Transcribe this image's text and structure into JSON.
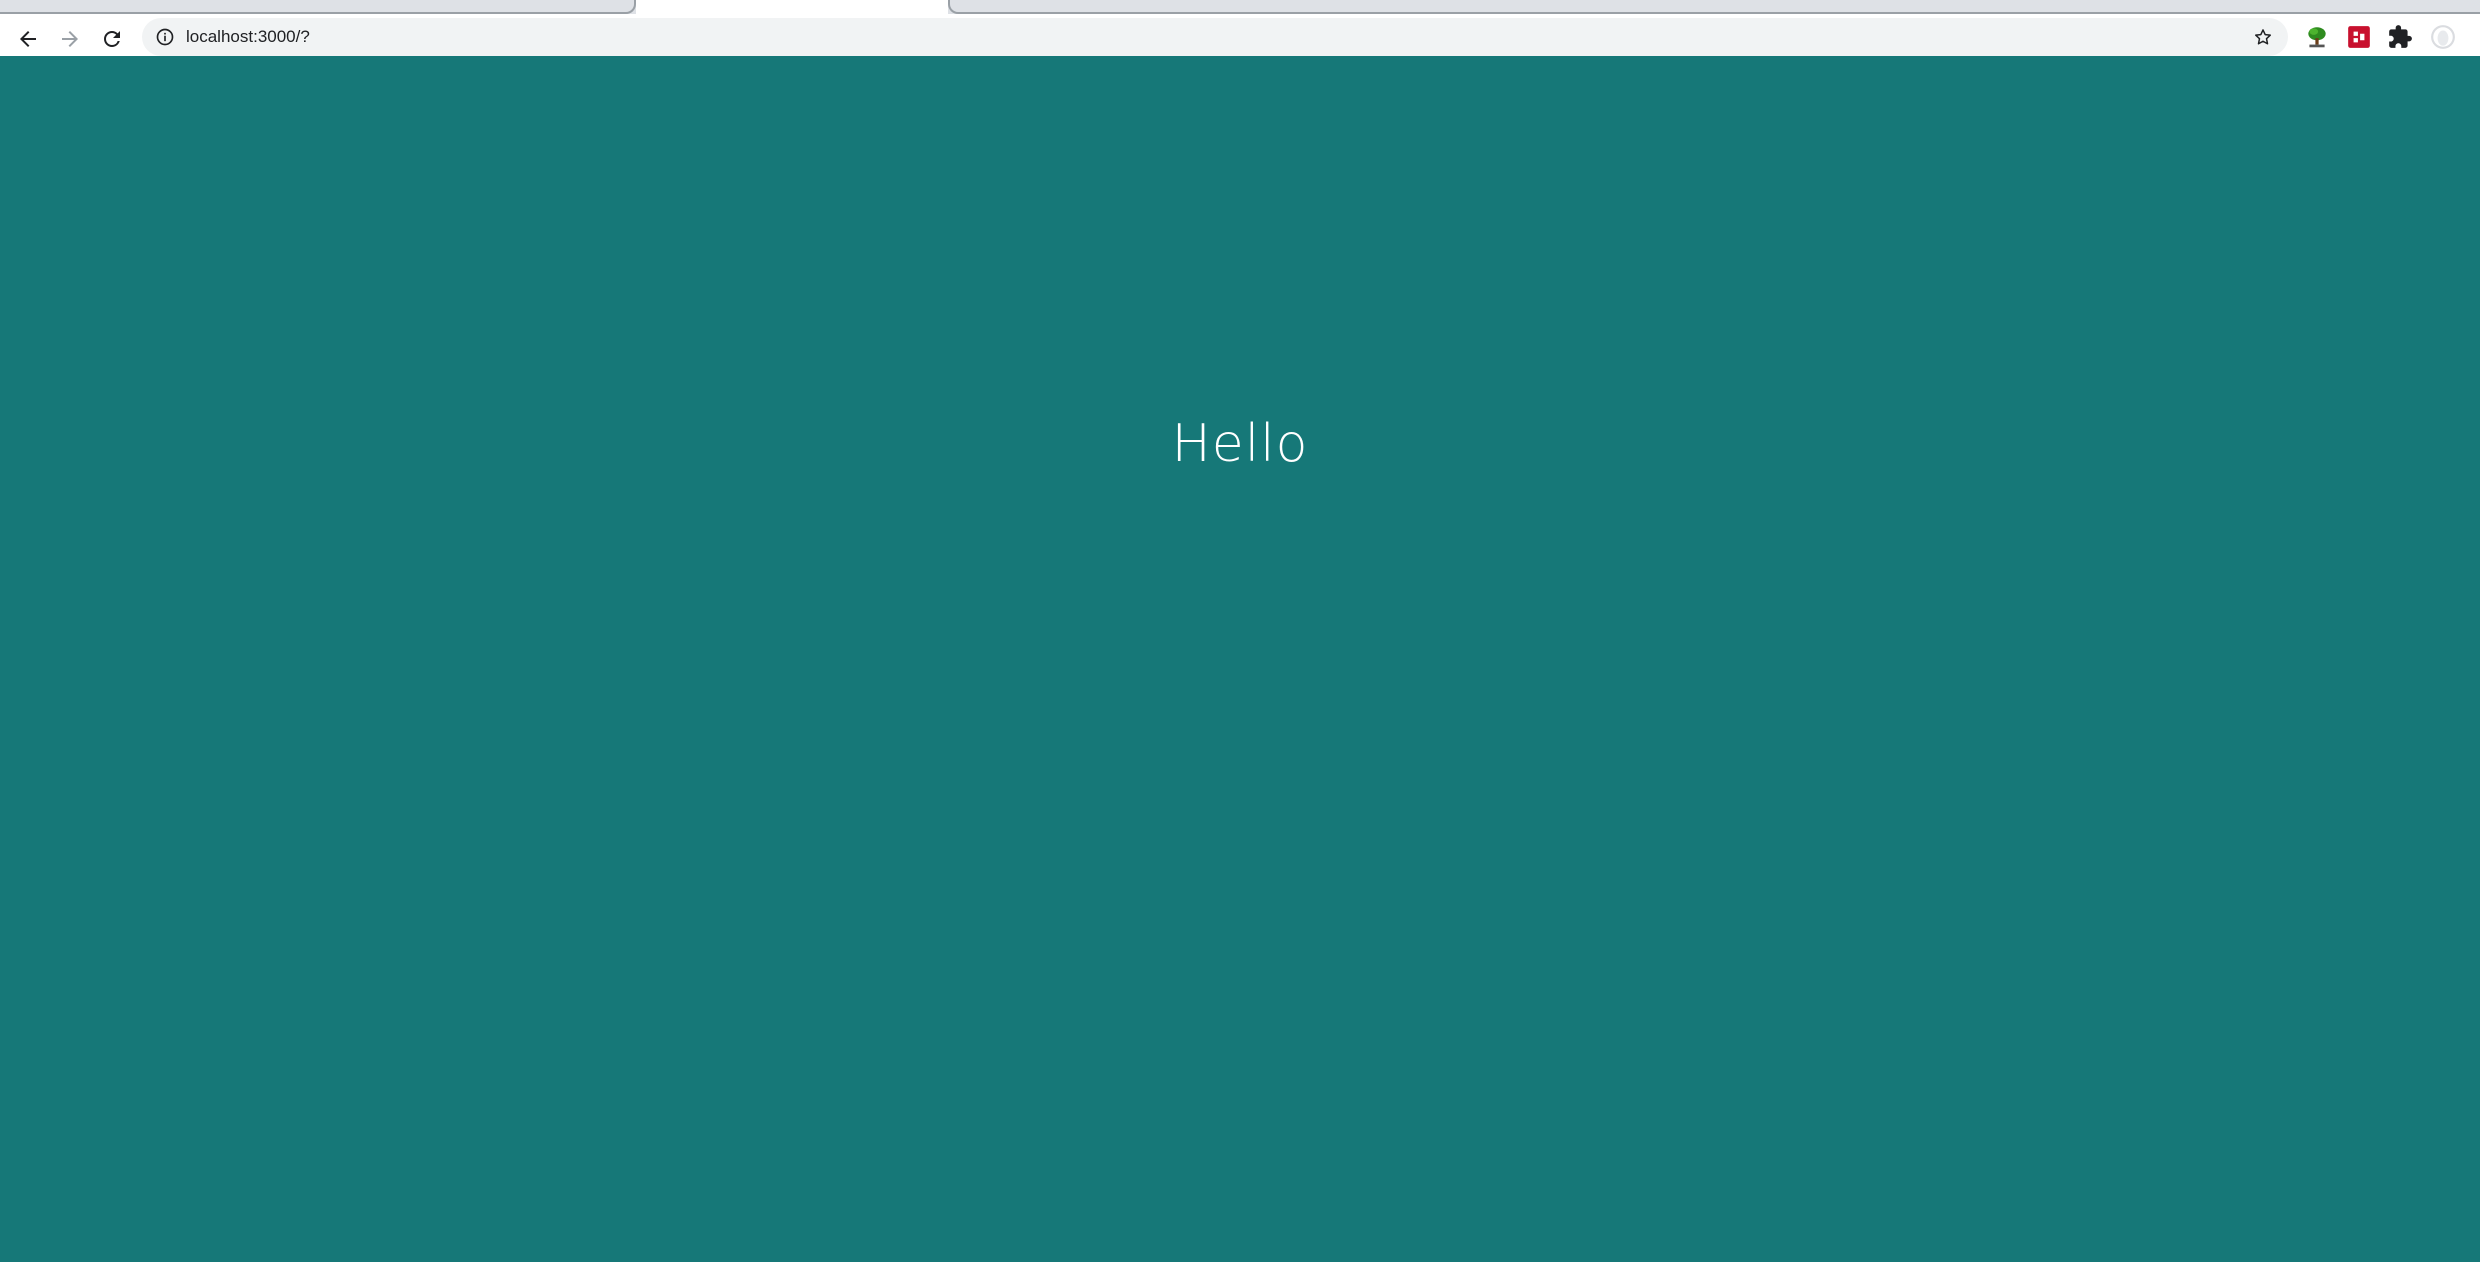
{
  "browser": {
    "url": "localhost:3000/?"
  },
  "page": {
    "heading": "Hello",
    "background_color": "#167878",
    "text_color": "#ffffff"
  },
  "toolbar_icons": {
    "back": "arrow-left-icon",
    "forward": "arrow-right-icon",
    "reload": "reload-icon",
    "site_info": "info-icon",
    "bookmark": "star-icon",
    "extension_1": "tree-extension-icon",
    "extension_2": "red-extension-icon",
    "extensions_menu": "puzzle-icon",
    "profile": "avatar-icon"
  }
}
